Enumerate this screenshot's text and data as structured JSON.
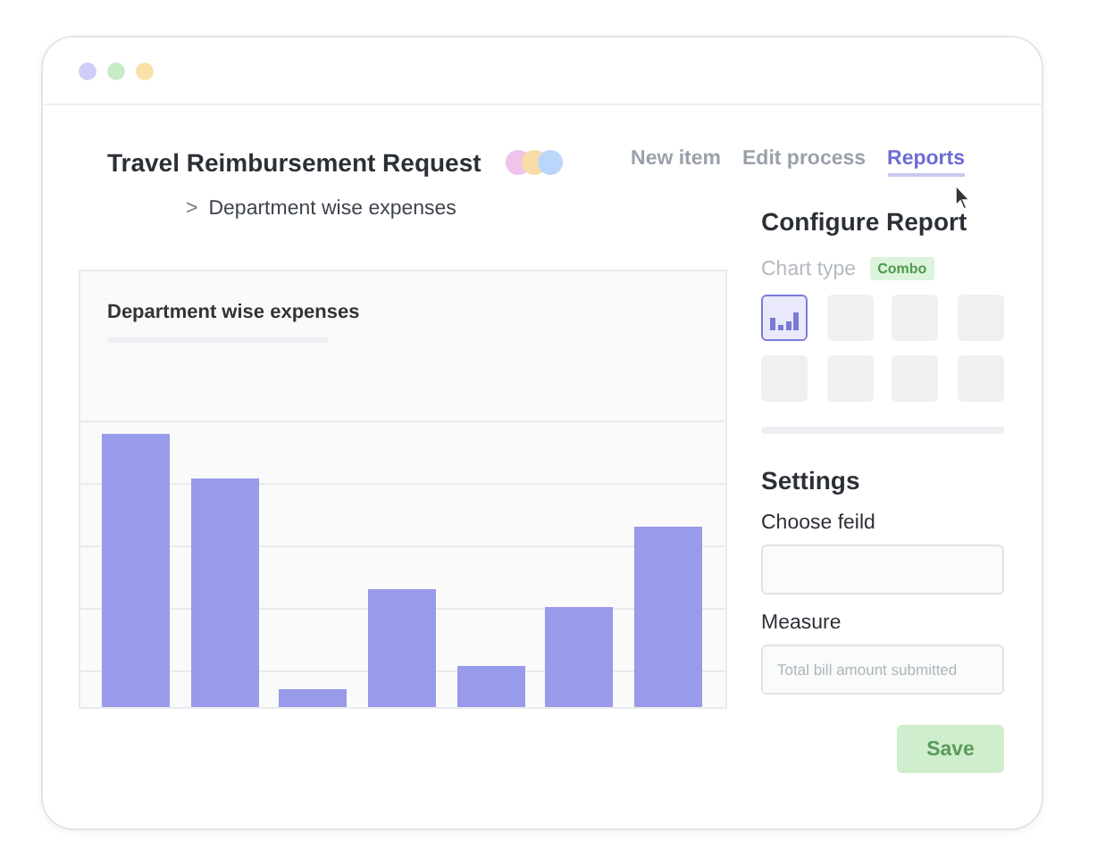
{
  "window": {
    "dots": [
      {
        "color": "#cfcdf7"
      },
      {
        "color": "#c8ecc8"
      },
      {
        "color": "#f8e2a8"
      }
    ]
  },
  "header": {
    "title": "Travel Reimbursement Request",
    "avatars": [
      {
        "color": "#efc3ea"
      },
      {
        "color": "#f8dca6"
      },
      {
        "color": "#bcd6fb"
      }
    ]
  },
  "tabs": [
    {
      "label": "New item",
      "selected": false
    },
    {
      "label": "Edit process",
      "selected": false
    },
    {
      "label": "Reports",
      "selected": true
    }
  ],
  "breadcrumb": {
    "separator": ">",
    "label": "Department wise expenses"
  },
  "chart_card": {
    "title": "Department wise expenses"
  },
  "configure": {
    "title": "Configure Report",
    "chart_type_label": "Chart type",
    "chart_type_badge": "Combo",
    "tiles": [
      {
        "kind": "bar",
        "selected": true
      },
      {
        "kind": "blank",
        "selected": false
      },
      {
        "kind": "blank",
        "selected": false
      },
      {
        "kind": "blank",
        "selected": false
      },
      {
        "kind": "blank",
        "selected": false
      },
      {
        "kind": "blank",
        "selected": false
      },
      {
        "kind": "blank",
        "selected": false
      },
      {
        "kind": "blank",
        "selected": false
      }
    ]
  },
  "settings": {
    "title": "Settings",
    "fields": [
      {
        "label": "Choose feild"
      },
      {
        "label": "Measure",
        "placeholder": "Total bill amount submitted"
      }
    ]
  },
  "save_button": {
    "label": "Save"
  }
}
